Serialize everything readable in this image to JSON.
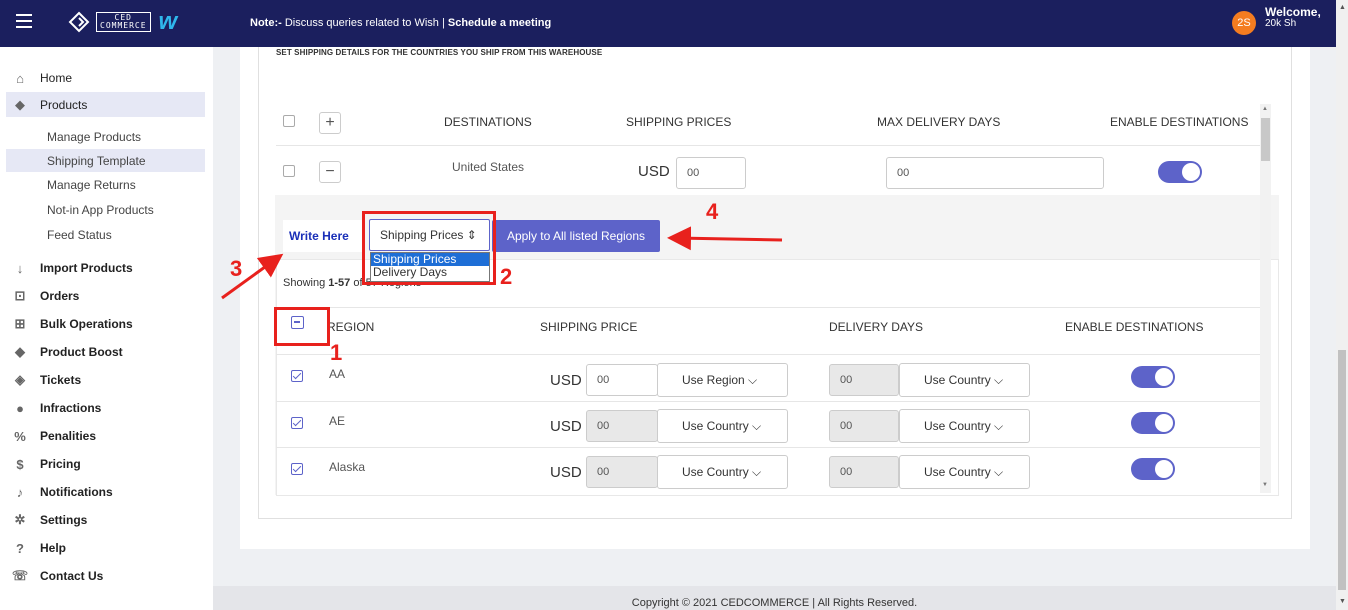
{
  "header": {
    "note_label": "Note:-",
    "note_text": " Discuss queries related to Wish | ",
    "schedule_link": "Schedule a meeting",
    "logo_line1": "CED",
    "logo_line2": "COMMERCE",
    "wish_logo": "w",
    "avatar_initials": "2S",
    "welcome": "Welcome,",
    "username": "20k Sh"
  },
  "sidebar": {
    "items": [
      {
        "label": "Home",
        "icon": "home-icon"
      },
      {
        "label": "Products",
        "icon": "tag-icon"
      },
      {
        "label": "Import Products",
        "icon": "arrow-down-icon"
      },
      {
        "label": "Orders",
        "icon": "inbox-icon"
      },
      {
        "label": "Bulk Operations",
        "icon": "grid-plus-icon"
      },
      {
        "label": "Product Boost",
        "icon": "tag-icon"
      },
      {
        "label": "Tickets",
        "icon": "ticket-icon"
      },
      {
        "label": "Infractions",
        "icon": "alert-icon"
      },
      {
        "label": "Penalities",
        "icon": "percent-icon"
      },
      {
        "label": "Pricing",
        "icon": "dollar-icon"
      },
      {
        "label": "Notifications",
        "icon": "bell-icon"
      },
      {
        "label": "Settings",
        "icon": "gear-icon"
      },
      {
        "label": "Help",
        "icon": "question-icon"
      },
      {
        "label": "Contact Us",
        "icon": "phone-icon"
      }
    ],
    "product_sub": [
      "Manage Products",
      "Shipping Template",
      "Manage Returns",
      "Not-in App Products",
      "Feed Status"
    ]
  },
  "main": {
    "section_title": "SET SHIPPING DETAILS FOR THE COUNTRIES YOU SHIP FROM THIS WAREHOUSE",
    "dest_table": {
      "headers": [
        "DESTINATIONS",
        "SHIPPING PRICES",
        "MAX DELIVERY DAYS",
        "ENABLE DESTINATIONS"
      ],
      "row": {
        "destination": "United States",
        "currency": "USD",
        "price": "00",
        "days": "00"
      }
    },
    "bulk": {
      "write_here": "Write Here",
      "selected_option": "Shipping Prices",
      "apply_button": "Apply to All listed Regions",
      "options": [
        "Shipping Prices",
        "Delivery Days"
      ]
    },
    "region_table": {
      "showing_prefix": "Showing ",
      "showing_range": "1-57",
      "showing_suffix": " of 57 Regions",
      "headers": [
        "REGION",
        "SHIPPING PRICE",
        "DELIVERY DAYS",
        "ENABLE DESTINATIONS"
      ],
      "rows": [
        {
          "region": "AA",
          "currency": "USD",
          "price": "00",
          "price_mode": "Use Region",
          "days": "00",
          "days_mode": "Use Country"
        },
        {
          "region": "AE",
          "currency": "USD",
          "price": "00",
          "price_mode": "Use Country",
          "days": "00",
          "days_mode": "Use Country"
        },
        {
          "region": "Alaska",
          "currency": "USD",
          "price": "00",
          "price_mode": "Use Country",
          "days": "00",
          "days_mode": "Use Country"
        }
      ]
    }
  },
  "annotations": [
    "1",
    "2",
    "3",
    "4"
  ],
  "footer": "Copyright © 2021 CEDCOMMERCE | All Rights Reserved.",
  "colors": {
    "topbar": "#1b1f5e",
    "accent": "#5d63c9",
    "annotation": "#e8211d",
    "avatar": "#f47c20"
  }
}
